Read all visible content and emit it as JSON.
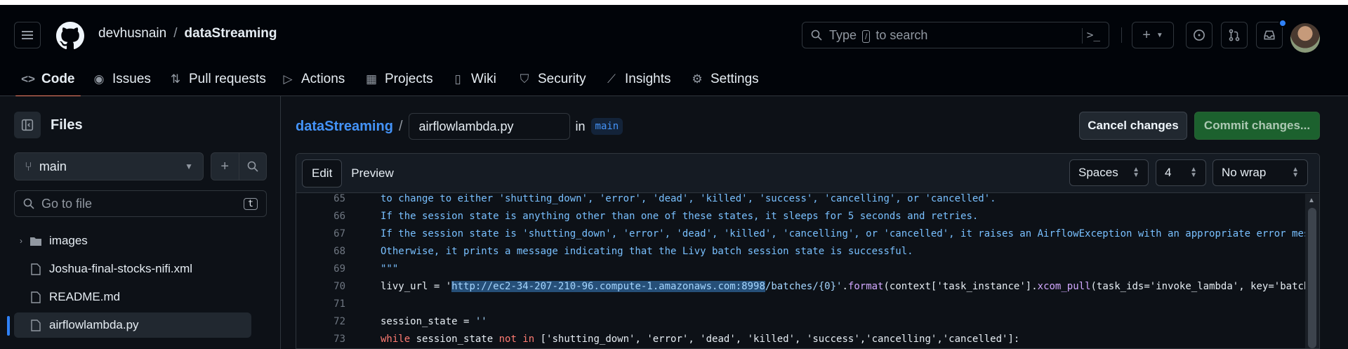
{
  "header": {
    "owner": "devhusnain",
    "separator": "/",
    "repo": "dataStreaming",
    "search": {
      "prefix": "Type",
      "key": "/",
      "suffix": "to search",
      "command_icon": ">_"
    }
  },
  "tabs": [
    {
      "label": "Code",
      "icon": "code-icon"
    },
    {
      "label": "Issues",
      "icon": "issue-icon"
    },
    {
      "label": "Pull requests",
      "icon": "pull-request-icon"
    },
    {
      "label": "Actions",
      "icon": "play-icon"
    },
    {
      "label": "Projects",
      "icon": "table-icon"
    },
    {
      "label": "Wiki",
      "icon": "book-icon"
    },
    {
      "label": "Security",
      "icon": "shield-icon"
    },
    {
      "label": "Insights",
      "icon": "graph-icon"
    },
    {
      "label": "Settings",
      "icon": "gear-icon"
    }
  ],
  "sidebar": {
    "title": "Files",
    "branch": "main",
    "goto_placeholder": "Go to file",
    "goto_key": "t",
    "tree": [
      {
        "name": "images",
        "type": "folder"
      },
      {
        "name": "Joshua-final-stocks-nifi.xml",
        "type": "file"
      },
      {
        "name": "README.md",
        "type": "file"
      },
      {
        "name": "airflowlambda.py",
        "type": "file",
        "selected": true
      }
    ]
  },
  "editor": {
    "repo_link": "dataStreaming",
    "slash": "/",
    "filename": "airflowlambda.py",
    "in_label": "in",
    "branch": "main",
    "cancel_label": "Cancel changes",
    "commit_label": "Commit changes...",
    "edit_tab": "Edit",
    "preview_tab": "Preview",
    "indent_mode": "Spaces",
    "indent_size": "4",
    "wrap_mode": "No wrap",
    "lines": [
      {
        "num": "66",
        "text": "If the session state is anything other than one of these states, it sleeps for 5 seconds and retries."
      },
      {
        "num": "67",
        "text": "If the session state is 'shutting_down', 'error', 'dead', 'killed', 'cancelling', or 'cancelled', it raises an AirflowException with an appropriate error messag"
      },
      {
        "num": "68",
        "text": "Otherwise, it prints a message indicating that the Livy batch session state is successful."
      },
      {
        "num": "69",
        "text": "\"\"\""
      },
      {
        "num": "70",
        "pre": "livy_url = '",
        "selected": "http://ec2-34-207-210-96.compute-1.amazonaws.com:8998",
        "post_str": "/batches/{0}'",
        "dot": ".",
        "fn1": "format",
        "mid": "(context['task_instance'].",
        "fn2": "xcom_pull",
        "tail": "(task_ids='invoke_lambda', key='batch_i"
      },
      {
        "num": "71",
        "text": ""
      },
      {
        "num": "72",
        "pre": "session_state = ",
        "str": "''"
      },
      {
        "num": "73",
        "kw1": "while",
        "mid": " session_state ",
        "kw2": "not in",
        "tail": " ['shutting_down', 'error', 'dead', 'killed', 'success','cancelling','cancelled']:"
      }
    ]
  }
}
